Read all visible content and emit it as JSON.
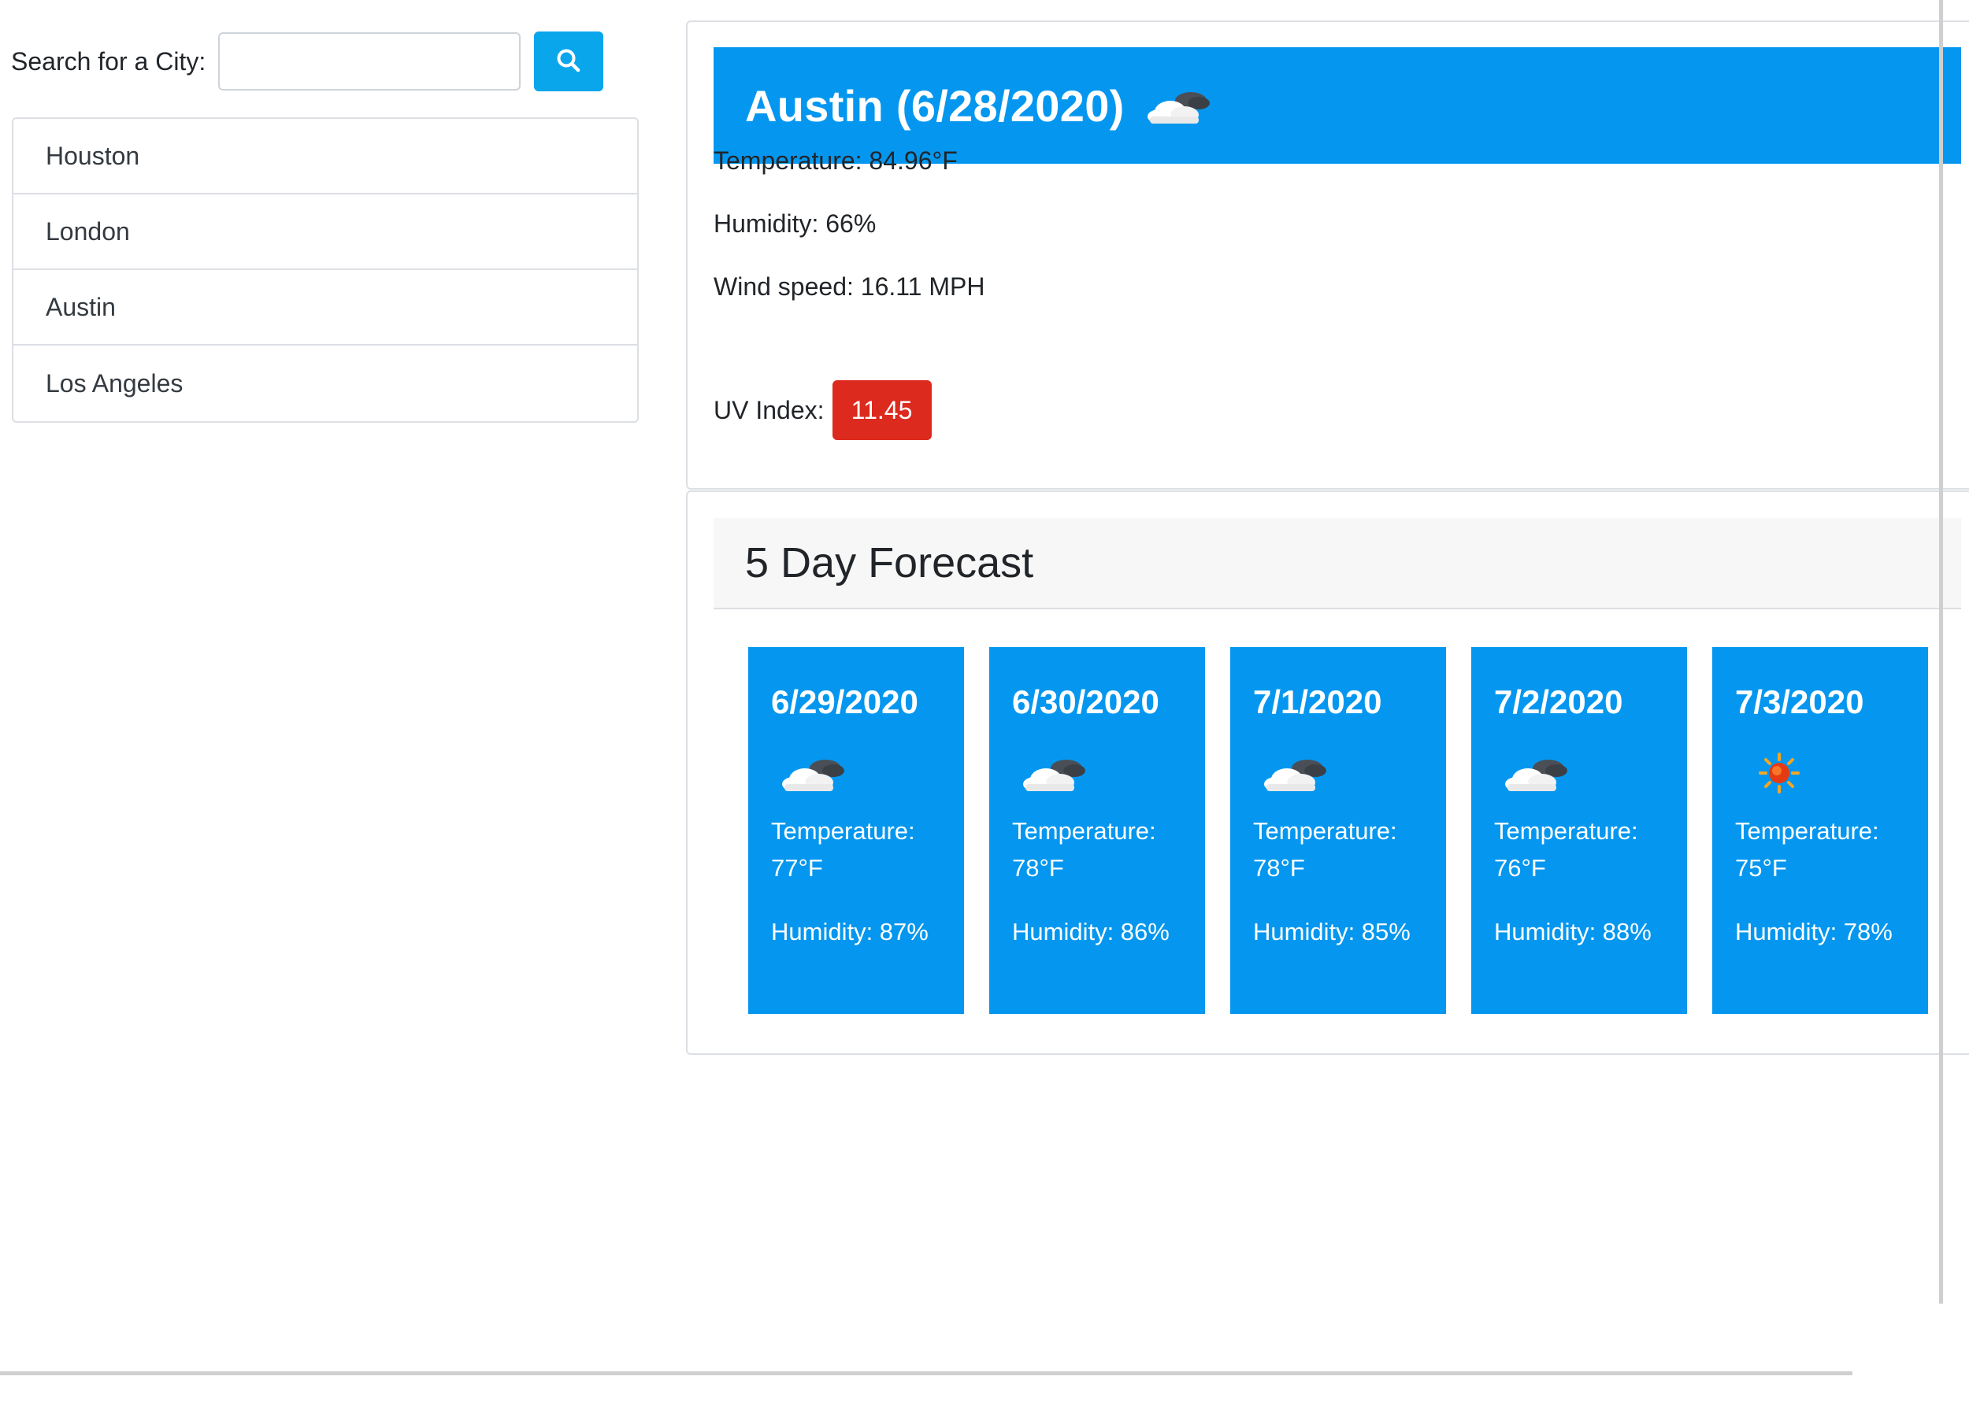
{
  "search": {
    "label": "Search for a City:",
    "value": "",
    "placeholder": ""
  },
  "history": {
    "cities": [
      "Houston",
      "London",
      "Austin",
      "Los Angeles"
    ]
  },
  "current": {
    "title": "Austin (6/28/2020)",
    "icon": "partly-cloudy-icon",
    "temperature": "Temperature: 84.96°F",
    "humidity": "Humidity: 66%",
    "wind": "Wind speed: 16.11 MPH",
    "uv_label": "UV Index:",
    "uv_value": "11.45",
    "uv_color": "#dc2a1e"
  },
  "forecast": {
    "title": "5 Day Forecast",
    "days": [
      {
        "date": "6/29/2020",
        "icon": "partly-cloudy-icon",
        "temp_label": "Temperature:",
        "temp": "77°F",
        "humidity": "Humidity: 87%"
      },
      {
        "date": "6/30/2020",
        "icon": "partly-cloudy-icon",
        "temp_label": "Temperature:",
        "temp": "78°F",
        "humidity": "Humidity: 86%"
      },
      {
        "date": "7/1/2020",
        "icon": "partly-cloudy-icon",
        "temp_label": "Temperature:",
        "temp": "78°F",
        "humidity": "Humidity: 85%"
      },
      {
        "date": "7/2/2020",
        "icon": "partly-cloudy-icon",
        "temp_label": "Temperature:",
        "temp": "76°F",
        "humidity": "Humidity: 88%"
      },
      {
        "date": "7/3/2020",
        "icon": "sun-icon",
        "temp_label": "Temperature:",
        "temp": "75°F",
        "humidity": "Humidity: 78%"
      }
    ]
  },
  "colors": {
    "accent": "#0597ef",
    "search_button": "#0aa6ec",
    "uv_badge": "#dc2a1e"
  }
}
